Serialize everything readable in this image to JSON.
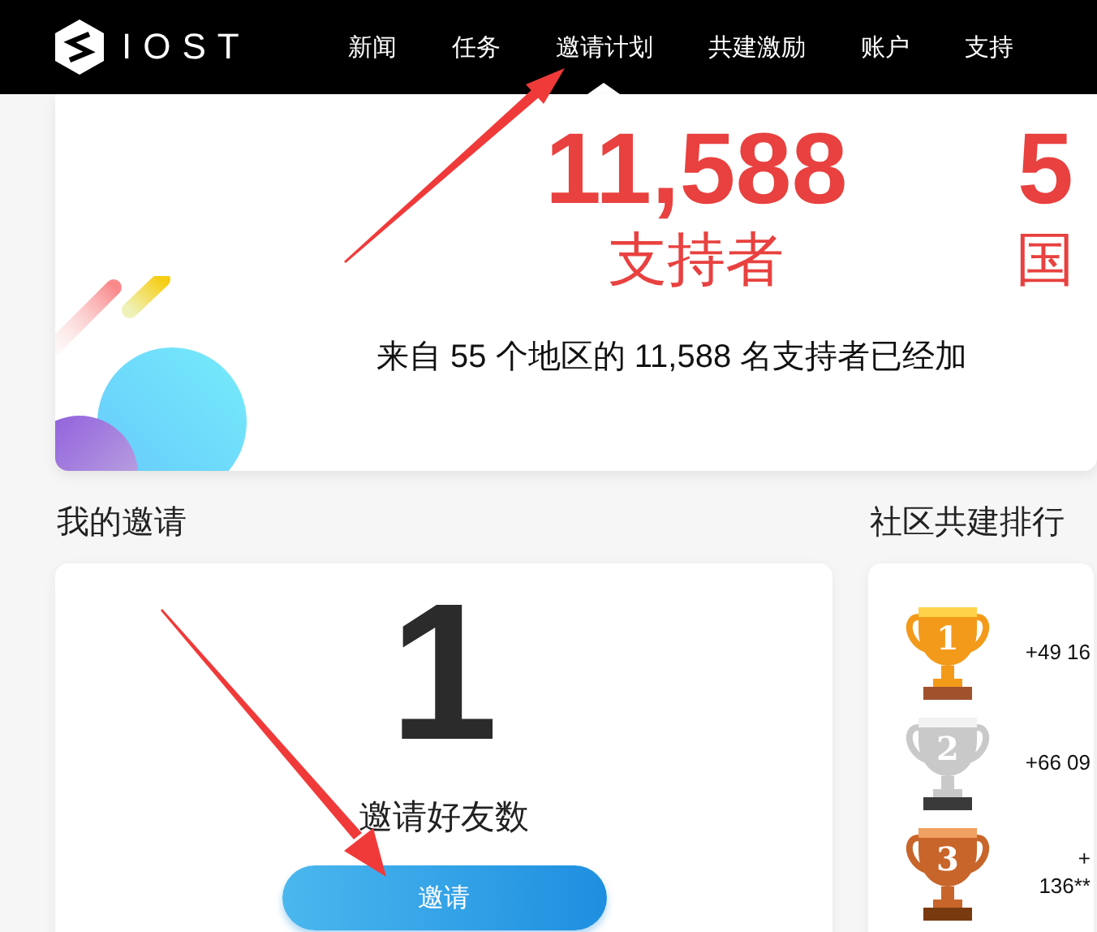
{
  "header": {
    "logo_text": "IOST",
    "nav": [
      {
        "label": "新闻",
        "selected": false
      },
      {
        "label": "任务",
        "selected": false
      },
      {
        "label": "邀请计划",
        "selected": true
      },
      {
        "label": "共建激励",
        "selected": false
      },
      {
        "label": "账户",
        "selected": false
      },
      {
        "label": "支持",
        "selected": false
      }
    ]
  },
  "banner": {
    "stats": [
      {
        "value": "11,588",
        "label": "支持者"
      },
      {
        "value": "5",
        "label": "国"
      }
    ],
    "sentence": "来自 55 个地区的 11,588 名支持者已经加"
  },
  "my_invites": {
    "title": "我的邀请",
    "count": "1",
    "count_label": "邀请好友数",
    "button": "邀请"
  },
  "leaderboard": {
    "title": "社区共建排行",
    "rows": [
      {
        "kind": "gold",
        "rank": "1",
        "lines": [
          "+49 16"
        ]
      },
      {
        "kind": "silver",
        "rank": "2",
        "lines": [
          "+66 09"
        ]
      },
      {
        "kind": "bronze",
        "rank": "3",
        "lines": [
          "+",
          "136**"
        ]
      }
    ]
  }
}
